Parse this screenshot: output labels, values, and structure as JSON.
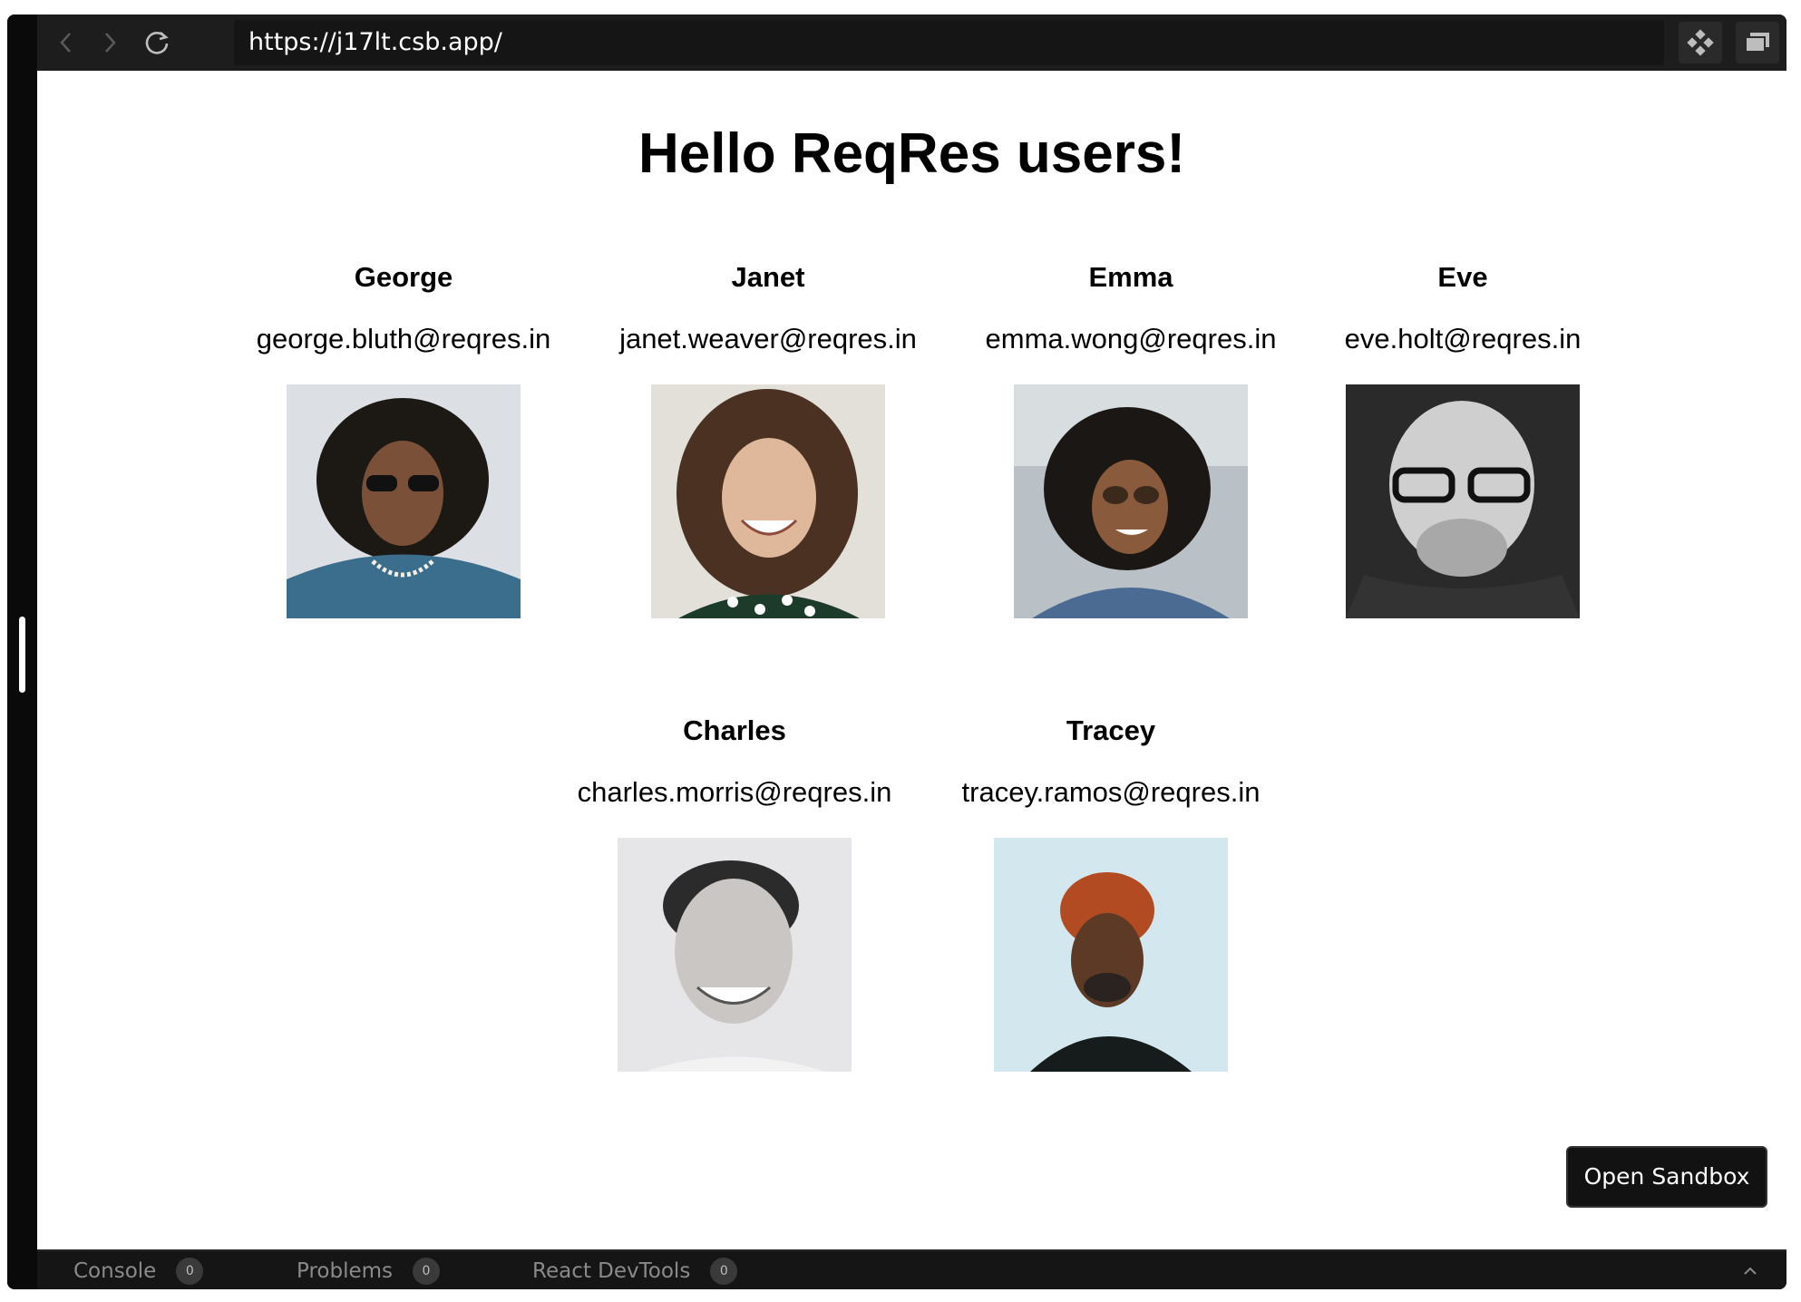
{
  "browser": {
    "url": "https://j17lt.csb.app/"
  },
  "page": {
    "title": "Hello ReqRes users!"
  },
  "users": [
    {
      "name": "George",
      "email": "george.bluth@reqres.in"
    },
    {
      "name": "Janet",
      "email": "janet.weaver@reqres.in"
    },
    {
      "name": "Emma",
      "email": "emma.wong@reqres.in"
    },
    {
      "name": "Eve",
      "email": "eve.holt@reqres.in"
    },
    {
      "name": "Charles",
      "email": "charles.morris@reqres.in"
    },
    {
      "name": "Tracey",
      "email": "tracey.ramos@reqres.in"
    }
  ],
  "open_sandbox_label": "Open Sandbox",
  "devtools": {
    "tabs": [
      {
        "label": "Console",
        "count": "0"
      },
      {
        "label": "Problems",
        "count": "0"
      },
      {
        "label": "React DevTools",
        "count": "0"
      }
    ]
  },
  "colors": {
    "chrome_dark": "#1d1d1d",
    "page_bg": "#ffffff",
    "text": "#000000"
  }
}
